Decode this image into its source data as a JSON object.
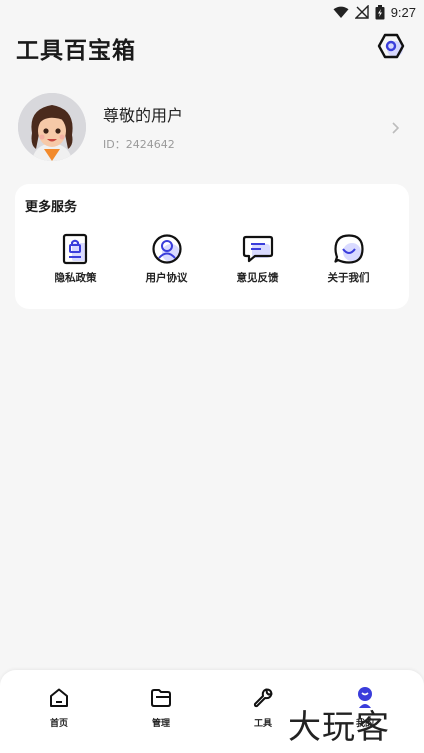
{
  "status_bar": {
    "time": "9:27"
  },
  "header": {
    "title": "工具百宝箱",
    "settings_icon": "settings-hexagon-icon"
  },
  "profile": {
    "name": "尊敬的用户",
    "id_text": "ID：2424642",
    "avatar_icon": "avatar-girl-icon"
  },
  "services": {
    "title": "更多服务",
    "items": [
      {
        "label": "隐私政策",
        "icon": "privacy-lock-icon"
      },
      {
        "label": "用户协议",
        "icon": "user-agreement-icon"
      },
      {
        "label": "意见反馈",
        "icon": "feedback-message-icon"
      },
      {
        "label": "关于我们",
        "icon": "about-chat-icon"
      }
    ]
  },
  "nav": {
    "items": [
      {
        "label": "首页",
        "icon": "home-icon"
      },
      {
        "label": "管理",
        "icon": "folder-icon"
      },
      {
        "label": "工具",
        "icon": "wrench-icon"
      },
      {
        "label": "我的",
        "icon": "user-icon",
        "active": true
      }
    ]
  },
  "colors": {
    "accent": "#3a3ddb",
    "background": "#f6f6f6",
    "card": "#ffffff"
  },
  "watermark": "大玩客"
}
